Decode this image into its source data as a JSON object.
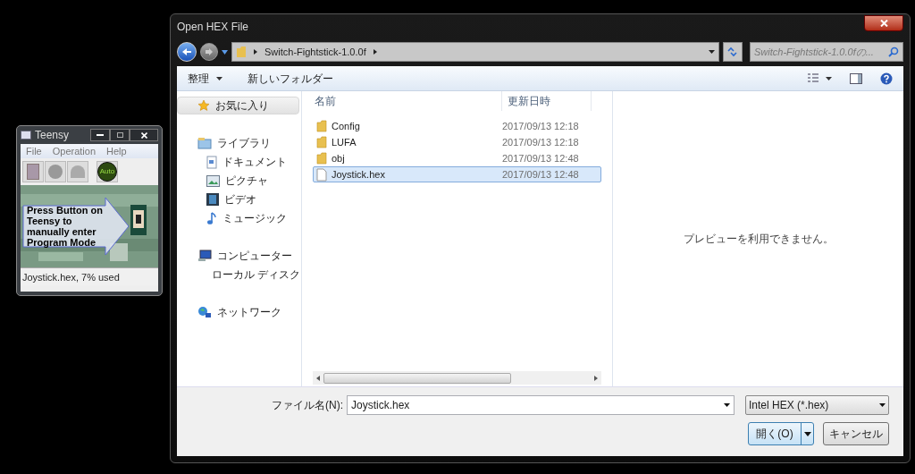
{
  "teensy": {
    "title": "Teensy",
    "menu": [
      "File",
      "Operation",
      "Help"
    ],
    "auto_label": "Auto",
    "banner": "Press Button on Teensy to manually enter Program Mode",
    "status": "Joystick.hex, 7% used"
  },
  "dialog": {
    "title": "Open HEX File",
    "breadcrumb": [
      "Switch-Fightstick-1.0.0f"
    ],
    "search": {
      "placeholder": "Switch-Fightstick-1.0.0fの..."
    },
    "toolbar": [
      {
        "label": "整理",
        "dropdown": true
      },
      {
        "label": "新しいフォルダー",
        "dropdown": false
      }
    ],
    "nav": [
      {
        "label": "お気に入り",
        "kind": "star",
        "selected": true
      },
      {
        "label": "ライブラリ",
        "kind": "library",
        "selected": false,
        "children": [
          {
            "label": "ドキュメント",
            "kind": "document",
            "selected": false
          },
          {
            "label": "ピクチャ",
            "kind": "picture",
            "selected": false
          },
          {
            "label": "ビデオ",
            "kind": "video",
            "selected": false
          },
          {
            "label": "ミュージック",
            "kind": "music",
            "selected": false
          }
        ]
      },
      {
        "label": "コンピューター",
        "kind": "computer",
        "selected": false,
        "children": [
          {
            "label": "ローカル ディスク",
            "kind": "disk",
            "selected": false
          }
        ]
      },
      {
        "label": "ネットワーク",
        "kind": "network",
        "selected": false
      }
    ],
    "columns": [
      "名前",
      "更新日時"
    ],
    "files": [
      {
        "name": "Config",
        "date": "2017/09/13 12:18",
        "kind": "folder",
        "selected": false
      },
      {
        "name": "LUFA",
        "date": "2017/09/13 12:18",
        "kind": "folder",
        "selected": false
      },
      {
        "name": "obj",
        "date": "2017/09/13 12:48",
        "kind": "folder",
        "selected": false
      },
      {
        "name": "Joystick.hex",
        "date": "2017/09/13 12:48",
        "kind": "file",
        "selected": true
      }
    ],
    "preview": "プレビューを利用できません。",
    "filename_label": "ファイル名(N):",
    "filename": "Joystick.hex",
    "filetype": "Intel HEX (*.hex)",
    "buttons": [
      {
        "label": "開く(O)",
        "kind": "split"
      },
      {
        "label": "キャンセル",
        "kind": "plain"
      }
    ]
  }
}
